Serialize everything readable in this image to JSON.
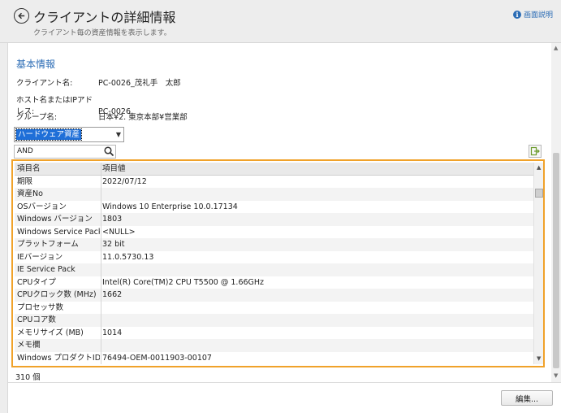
{
  "header": {
    "title": "クライアントの詳細情報",
    "subtitle": "クライアント毎の資産情報を表示します。",
    "help_label": "画面説明",
    "help_icon": "info-icon",
    "back_icon": "back-arrow-icon"
  },
  "basic_info": {
    "section_title": "基本情報",
    "rows": [
      {
        "label": "クライアント名:",
        "value": "PC-0026_茂礼手　太郎"
      },
      {
        "label": "ホスト名またはIPアドレス:",
        "value": "PC-0026"
      },
      {
        "label": "グループ名:",
        "value": "日本¥2. 東京本部¥営業部"
      }
    ]
  },
  "filter": {
    "category_selected": "ハードウェア資産",
    "search_value": "AND"
  },
  "grid": {
    "columns": [
      "項目名",
      "項目値"
    ],
    "rows": [
      [
        "期限",
        "2022/07/12"
      ],
      [
        "資産No",
        ""
      ],
      [
        "OSバージョン",
        "Windows 10 Enterprise 10.0.17134"
      ],
      [
        "Windows バージョン",
        "1803"
      ],
      [
        "Windows Service Pack",
        "<NULL>"
      ],
      [
        "プラットフォーム",
        "32 bit"
      ],
      [
        "IEバージョン",
        "11.0.5730.13"
      ],
      [
        "IE Service Pack",
        ""
      ],
      [
        "CPUタイプ",
        "Intel(R) Core(TM)2 CPU T5500 @ 1.66GHz"
      ],
      [
        "CPUクロック数 (MHz)",
        "1662"
      ],
      [
        "プロセッサ数",
        ""
      ],
      [
        "CPUコア数",
        ""
      ],
      [
        "メモリサイズ (MB)",
        "1014"
      ],
      [
        "メモ欄",
        ""
      ],
      [
        "Windows プロダクトID",
        "76494-OEM-0011903-00107"
      ]
    ]
  },
  "footer": {
    "count_label": "310 個",
    "edit_label": "編集..."
  },
  "colors": {
    "accent": "#2b6cb5",
    "highlight_frame": "#f0a22a",
    "selection": "#1f6fd8"
  }
}
